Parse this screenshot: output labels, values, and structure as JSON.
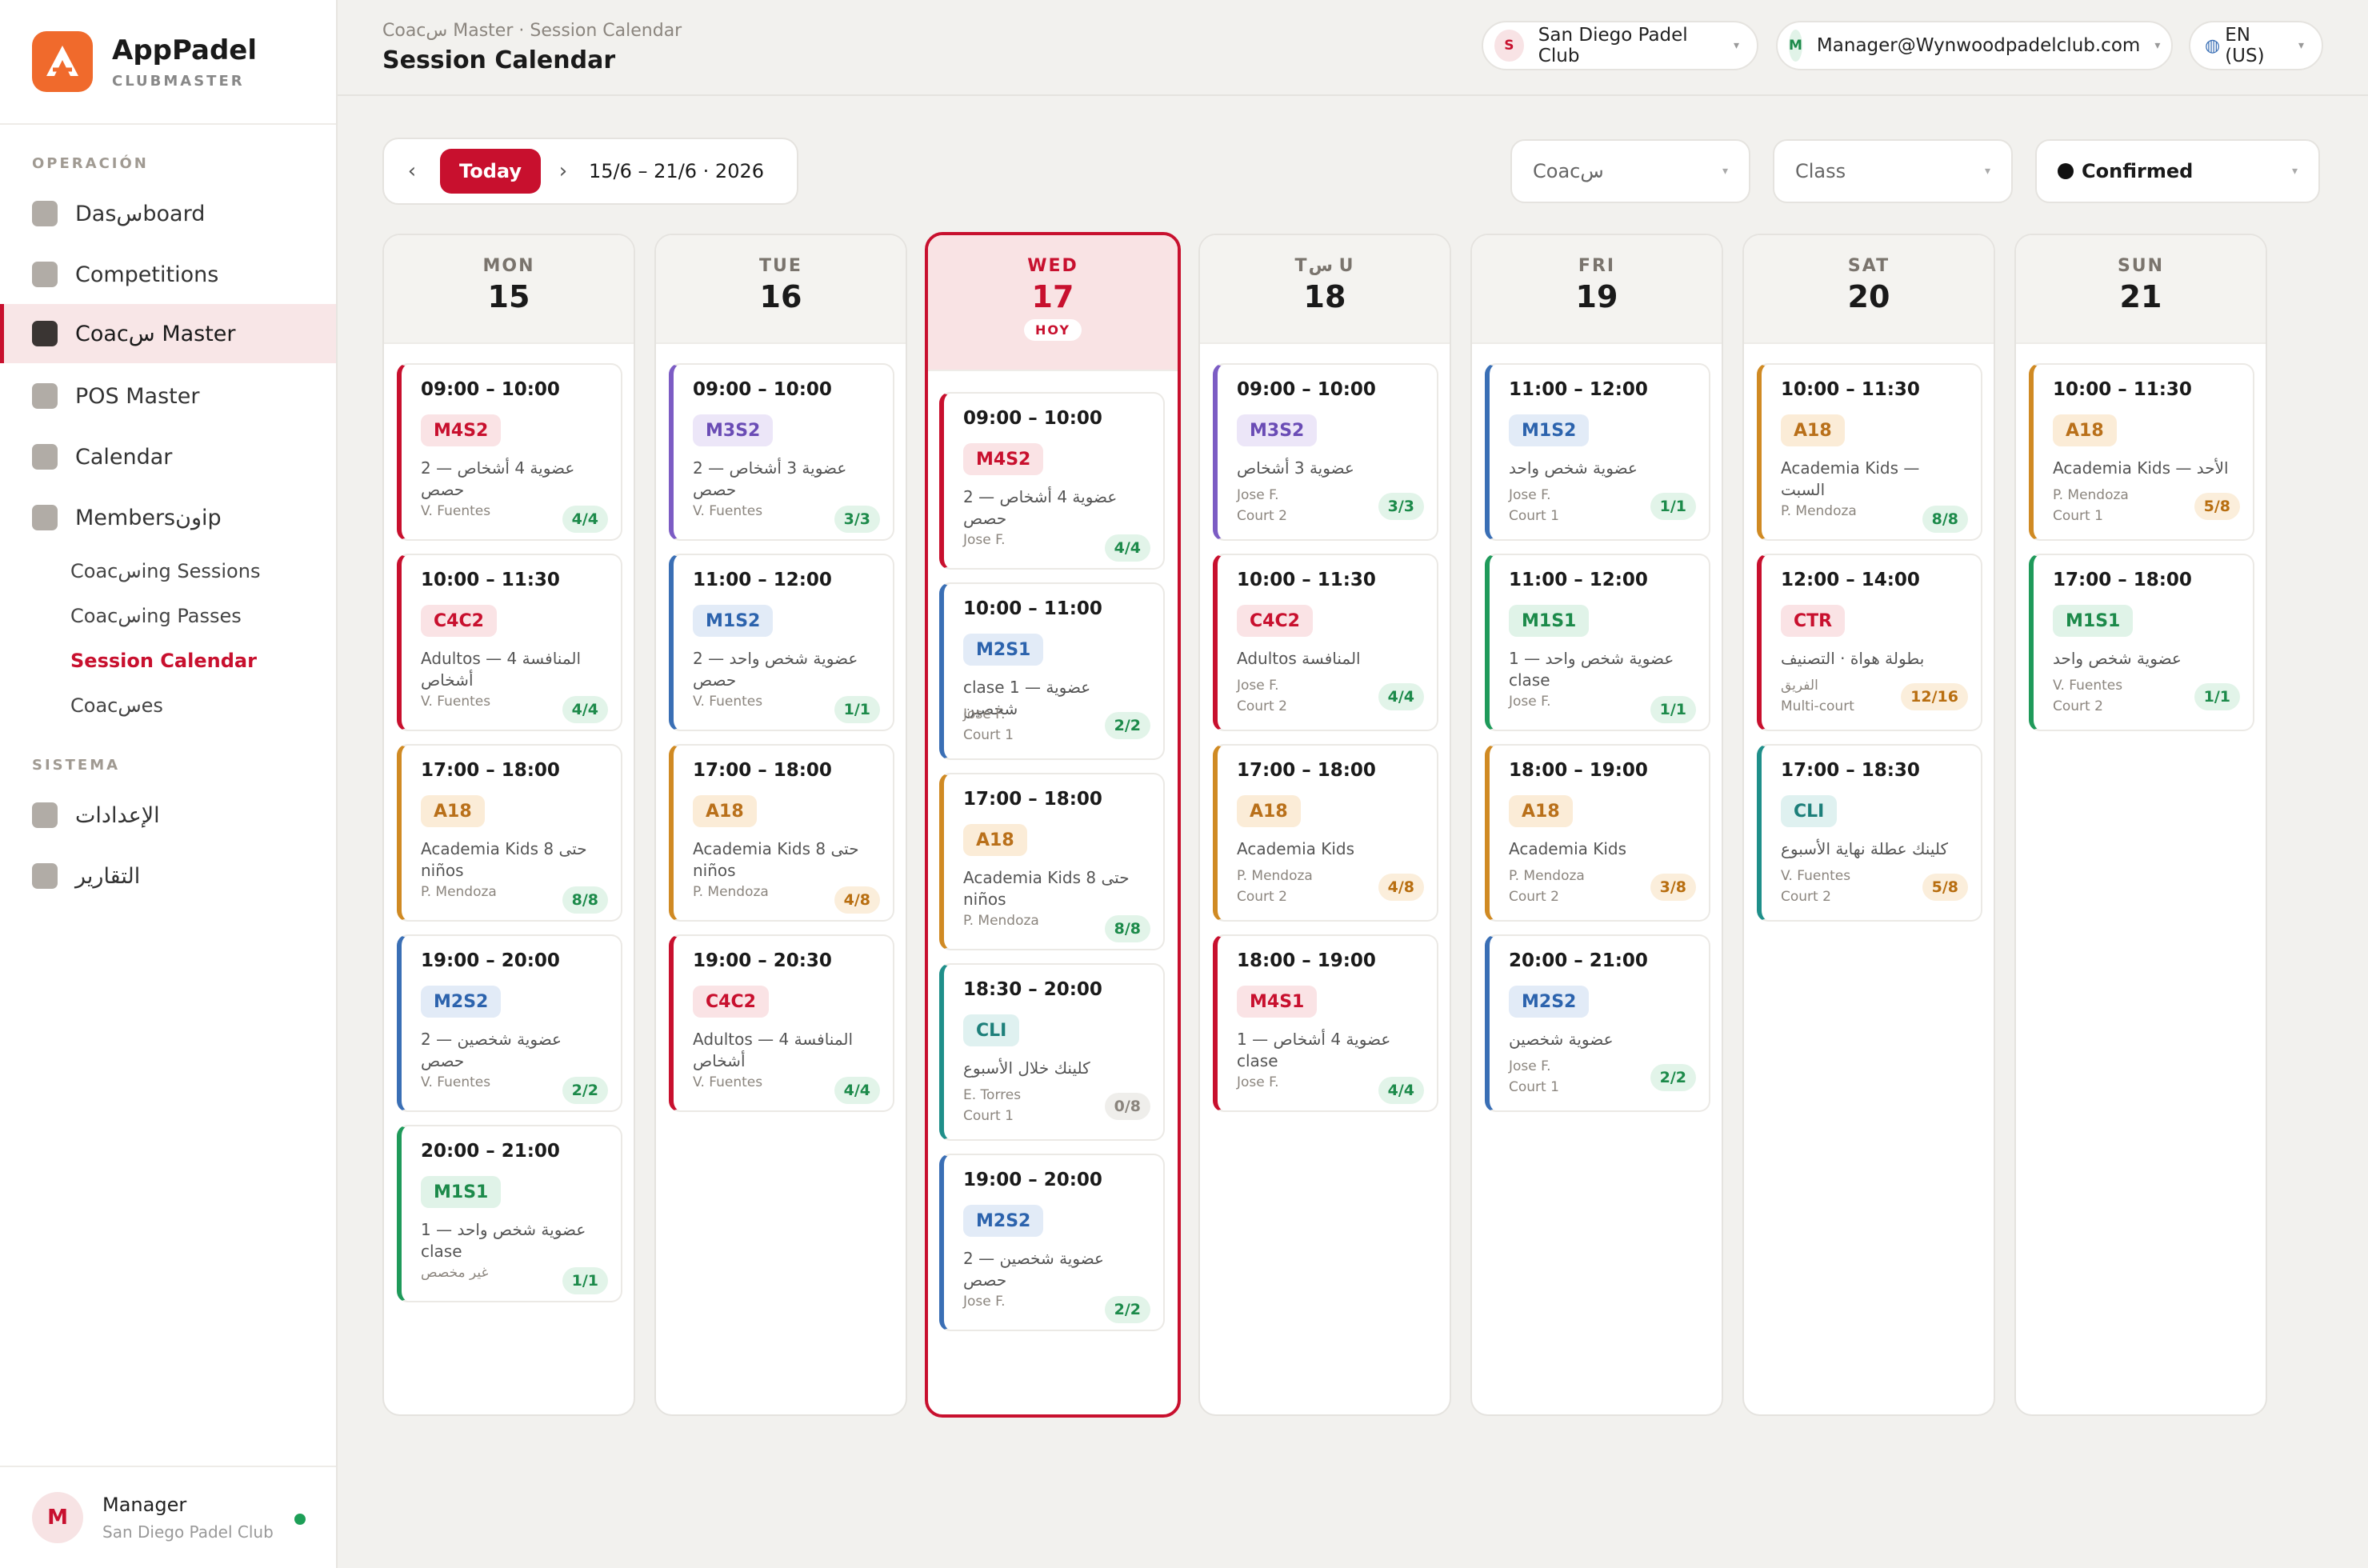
{
  "brand": {
    "name": "AppPadel",
    "subtitle": "CLUBMASTER",
    "logo_icon": "padel-logo-icon",
    "logo_color": "#f06a2c"
  },
  "sidebar": {
    "section1": "OPERACIÓN",
    "items": [
      {
        "label": "Dasسboard",
        "icon": "dashboard-icon"
      },
      {
        "label": "Competitions",
        "icon": "trophy-icon"
      },
      {
        "label": "Coacس Master",
        "icon": "coach-icon",
        "active": true
      },
      {
        "label": "POS Master",
        "icon": "pos-icon"
      },
      {
        "label": "Calendar",
        "icon": "calendar-icon"
      },
      {
        "label": "Membersونip",
        "icon": "members-icon"
      }
    ],
    "subitems": [
      "Coacسing Sessions",
      "Coacسing Passes",
      "Session Calendar",
      "Coacسes"
    ],
    "section2": "SISTEMA",
    "system_items": [
      {
        "label": "الإعدادات",
        "icon": "settings-icon"
      },
      {
        "label": "التقارير",
        "icon": "reports-icon"
      }
    ],
    "footer": {
      "avatar": "M",
      "name": "Manager",
      "club": "San Diego Padel Club"
    }
  },
  "header": {
    "breadcrumb": "Coacس Master · Session Calendar",
    "title": "Session Calendar",
    "club": {
      "initial": "S",
      "label": "San Diego Padel Club"
    },
    "user": {
      "initial": "M",
      "label": "Manager@Wynwoodpadelclub.com"
    },
    "lang": {
      "icon": "globe-icon",
      "label": "EN (US)"
    }
  },
  "toolbar": {
    "prev": "‹",
    "next": "›",
    "today": "Today",
    "range": "15/6 – 21/6 · 2026",
    "filters": {
      "coach": "Coacس",
      "type": "Class",
      "status": "Confirmed"
    }
  },
  "colors": {
    "accent": "#c8102e",
    "types": {
      "red": {
        "stripe": "#c8102e",
        "bg": "#fae3e5",
        "fg": "#c8102e"
      },
      "purple": {
        "stripe": "#7c5cc4",
        "bg": "#ece6f8",
        "fg": "#6a4cb5"
      },
      "blue": {
        "stripe": "#3a6fb5",
        "bg": "#e2ebf7",
        "fg": "#2c63ad"
      },
      "amber": {
        "stripe": "#d08a23",
        "bg": "#fbecd7",
        "fg": "#b9701a"
      },
      "green": {
        "stripe": "#1f9a5a",
        "bg": "#e0f3e8",
        "fg": "#1c8a4a"
      },
      "teal": {
        "stripe": "#1f8f8a",
        "bg": "#dff1f0",
        "fg": "#1d7f7a"
      }
    }
  },
  "days": [
    {
      "dow": "MON",
      "num": "15",
      "sessions": [
        {
          "time": "09:00 – 10:00",
          "code": "M4S2",
          "color": "red",
          "desc": "2 — عضوية 4 أشخاص حصص",
          "meta1": "V. Fuentes",
          "meta2": "",
          "count": "4/4",
          "cnt": "green"
        },
        {
          "time": "10:00 – 11:30",
          "code": "C4C2",
          "color": "red",
          "desc": "Adultos — المنافسة 4 أشخاص",
          "meta1": "V. Fuentes",
          "meta2": "",
          "count": "4/4",
          "cnt": "green"
        },
        {
          "time": "17:00 – 18:00",
          "code": "A18",
          "color": "amber",
          "desc": "Academia Kids حتى 8 niños",
          "meta1": "P. Mendoza",
          "meta2": "",
          "count": "8/8",
          "cnt": "green"
        },
        {
          "time": "19:00 – 20:00",
          "code": "M2S2",
          "color": "blue",
          "desc": "2 — عضوية شخصين حصص",
          "meta1": "V. Fuentes",
          "meta2": "",
          "count": "2/2",
          "cnt": "green"
        },
        {
          "time": "20:00 – 21:00",
          "code": "M1S1",
          "color": "green",
          "desc": "1 — عضوية شخص واحد clase",
          "meta1": "غير مخصص",
          "meta2": "",
          "count": "1/1",
          "cnt": "green"
        }
      ]
    },
    {
      "dow": "TUE",
      "num": "16",
      "sessions": [
        {
          "time": "09:00 – 10:00",
          "code": "M3S2",
          "color": "purple",
          "desc": "2 — عضوية 3 أشخاص حصص",
          "meta1": "V. Fuentes",
          "meta2": "",
          "count": "3/3",
          "cnt": "green"
        },
        {
          "time": "11:00 – 12:00",
          "code": "M1S2",
          "color": "blue",
          "desc": "2 — عضوية شخص واحد حصص",
          "meta1": "V. Fuentes",
          "meta2": "",
          "count": "1/1",
          "cnt": "green"
        },
        {
          "time": "17:00 – 18:00",
          "code": "A18",
          "color": "amber",
          "desc": "Academia Kids حتى 8 niños",
          "meta1": "P. Mendoza",
          "meta2": "",
          "count": "4/8",
          "cnt": "amber"
        },
        {
          "time": "19:00 – 20:30",
          "code": "C4C2",
          "color": "red",
          "desc": "Adultos — المنافسة 4 أشخاص",
          "meta1": "V. Fuentes",
          "meta2": "",
          "count": "4/4",
          "cnt": "green"
        }
      ]
    },
    {
      "dow": "WED",
      "num": "17",
      "today": true,
      "badge": "HOY",
      "sessions": [
        {
          "time": "09:00 – 10:00",
          "code": "M4S2",
          "color": "red",
          "desc": "2 — عضوية 4 أشخاص حصص",
          "meta1": "Jose F.",
          "meta2": "",
          "count": "4/4",
          "cnt": "green"
        },
        {
          "time": "10:00 – 11:00",
          "code": "M2S1",
          "color": "blue",
          "desc": "clase 1 — عضوية شخصين",
          "meta1": "Jose F.",
          "meta2": "Court 1",
          "count": "2/2",
          "cnt": "green"
        },
        {
          "time": "17:00 – 18:00",
          "code": "A18",
          "color": "amber",
          "desc": "Academia Kids حتى 8 niños",
          "meta1": "P. Mendoza",
          "meta2": "",
          "count": "8/8",
          "cnt": "green"
        },
        {
          "time": "18:30 – 20:00",
          "code": "CLI",
          "color": "teal",
          "desc": "كلينك خلال الأسبوع",
          "meta1": "E. Torres",
          "meta2": "Court 1",
          "count": "0/8",
          "cnt": "grey"
        },
        {
          "time": "19:00 – 20:00",
          "code": "M2S2",
          "color": "blue",
          "desc": "2 — عضوية شخصين حصص",
          "meta1": "Jose F.",
          "meta2": "",
          "count": "2/2",
          "cnt": "green"
        }
      ]
    },
    {
      "dow": "Tس U",
      "num": "18",
      "sessions": [
        {
          "time": "09:00 – 10:00",
          "code": "M3S2",
          "color": "purple",
          "desc": "عضوية 3 أشخاص",
          "meta1": "Jose F.",
          "meta2": "Court 2",
          "count": "3/3",
          "cnt": "green"
        },
        {
          "time": "10:00 – 11:30",
          "code": "C4C2",
          "color": "red",
          "desc": "Adultos المنافسة",
          "meta1": "Jose F.",
          "meta2": "Court 2",
          "count": "4/4",
          "cnt": "green"
        },
        {
          "time": "17:00 – 18:00",
          "code": "A18",
          "color": "amber",
          "desc": "Academia Kids",
          "meta1": "P. Mendoza",
          "meta2": "Court 2",
          "count": "4/8",
          "cnt": "amber"
        },
        {
          "time": "18:00 – 19:00",
          "code": "M4S1",
          "color": "red",
          "desc": "1 — عضوية 4 أشخاص clase",
          "meta1": "Jose F.",
          "meta2": "",
          "count": "4/4",
          "cnt": "green"
        }
      ]
    },
    {
      "dow": "FRI",
      "num": "19",
      "sessions": [
        {
          "time": "11:00 – 12:00",
          "code": "M1S2",
          "color": "blue",
          "desc": "عضوية شخص واحد",
          "meta1": "Jose F.",
          "meta2": "Court 1",
          "count": "1/1",
          "cnt": "green"
        },
        {
          "time": "11:00 – 12:00",
          "code": "M1S1",
          "color": "green",
          "desc": "1 — عضوية شخص واحد clase",
          "meta1": "Jose F.",
          "meta2": "",
          "count": "1/1",
          "cnt": "green"
        },
        {
          "time": "18:00 – 19:00",
          "code": "A18",
          "color": "amber",
          "desc": "Academia Kids",
          "meta1": "P. Mendoza",
          "meta2": "Court 2",
          "count": "3/8",
          "cnt": "amber"
        },
        {
          "time": "20:00 – 21:00",
          "code": "M2S2",
          "color": "blue",
          "desc": "عضوية شخصين",
          "meta1": "Jose F.",
          "meta2": "Court 1",
          "count": "2/2",
          "cnt": "green"
        }
      ]
    },
    {
      "dow": "SAT",
      "num": "20",
      "sessions": [
        {
          "time": "10:00 – 11:30",
          "code": "A18",
          "color": "amber",
          "desc": "Academia Kids — السبت",
          "meta1": "P. Mendoza",
          "meta2": "",
          "count": "8/8",
          "cnt": "green"
        },
        {
          "time": "12:00 – 14:00",
          "code": "CTR",
          "color": "red",
          "desc": "بطولة هواة · التصنيف",
          "meta1": "الفريق",
          "meta2": "Multi-court",
          "count": "12/16",
          "cnt": "amber"
        },
        {
          "time": "17:00 – 18:30",
          "code": "CLI",
          "color": "teal",
          "desc": "كلينك عطلة نهاية الأسبوع",
          "meta1": "V. Fuentes",
          "meta2": "Court 2",
          "count": "5/8",
          "cnt": "amber"
        }
      ]
    },
    {
      "dow": "SUN",
      "num": "21",
      "sessions": [
        {
          "time": "10:00 – 11:30",
          "code": "A18",
          "color": "amber",
          "desc": "Academia Kids — الأحد",
          "meta1": "P. Mendoza",
          "meta2": "Court 1",
          "count": "5/8",
          "cnt": "amber"
        },
        {
          "time": "17:00 – 18:00",
          "code": "M1S1",
          "color": "green",
          "desc": "عضوية شخص واحد",
          "meta1": "V. Fuentes",
          "meta2": "Court 2",
          "count": "1/1",
          "cnt": "green"
        }
      ]
    }
  ]
}
